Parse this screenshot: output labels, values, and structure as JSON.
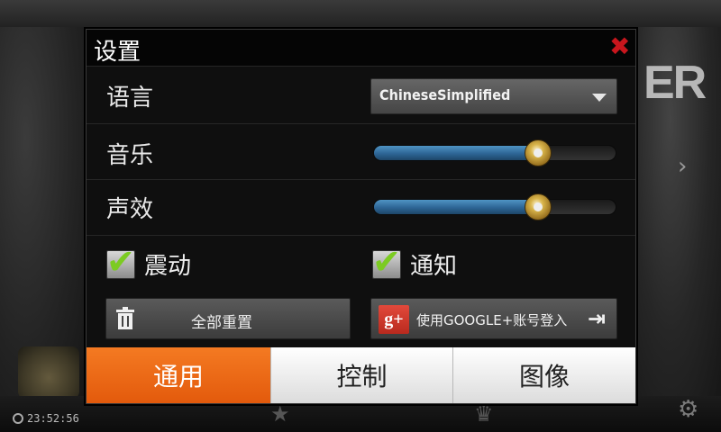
{
  "background": {
    "logo_fragment": "ER",
    "clock": "23:52:56"
  },
  "dialog": {
    "title": "设置",
    "close_icon": "close-x-icon",
    "language": {
      "label": "语言",
      "selected": "ChineseSimplified"
    },
    "music": {
      "label": "音乐",
      "level": 0.68
    },
    "sound_effects": {
      "label": "声效",
      "level": 0.68
    },
    "vibration": {
      "label": "震动",
      "checked": true
    },
    "notifications": {
      "label": "通知",
      "checked": true
    },
    "reset_button": {
      "label": "全部重置",
      "icon": "trash-icon"
    },
    "google_button": {
      "label": "使用GOOGLE+账号登入",
      "icon": "google-plus-icon"
    },
    "tabs": [
      {
        "label": "通用",
        "active": true
      },
      {
        "label": "控制",
        "active": false
      },
      {
        "label": "图像",
        "active": false
      }
    ]
  },
  "colors": {
    "accent": "#e8650f",
    "close": "#c8161d",
    "check": "#7ccb22",
    "slider": "#2d6595"
  }
}
